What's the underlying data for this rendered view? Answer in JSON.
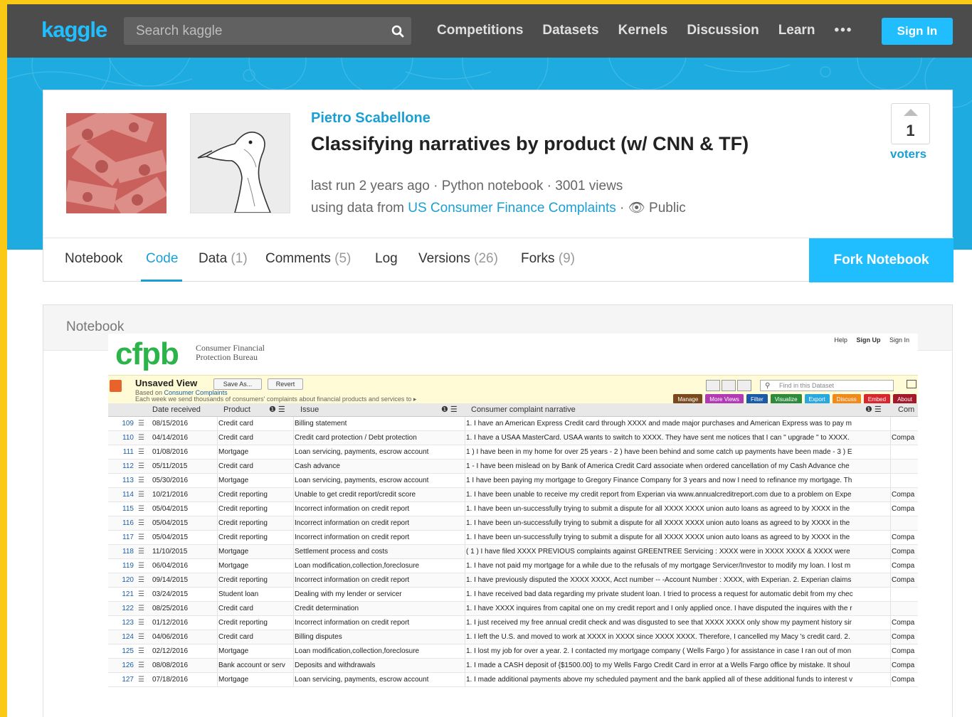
{
  "nav": {
    "logo": "kaggle",
    "search_placeholder": "Search kaggle",
    "links": [
      "Competitions",
      "Datasets",
      "Kernels",
      "Discussion",
      "Learn"
    ],
    "more": "•••",
    "signin": "Sign In"
  },
  "kernel": {
    "author": "Pietro Scabellone",
    "title": "Classifying narratives by product (w/ CNN & TF)",
    "meta_line1": "last run 2 years ago · Python notebook · 3001 views",
    "meta_prefix": "using data from ",
    "dataset_link": "US Consumer Finance Complaints",
    "meta_suffix": " · 👁 Public",
    "votes": "1",
    "voters_label": "voters"
  },
  "tabs": [
    {
      "label": "Notebook",
      "count": ""
    },
    {
      "label": "Code",
      "count": ""
    },
    {
      "label": "Data",
      "count": "(1)"
    },
    {
      "label": "Comments",
      "count": "(5)"
    },
    {
      "label": "Log",
      "count": ""
    },
    {
      "label": "Versions",
      "count": "(26)"
    },
    {
      "label": "Forks",
      "count": "(9)"
    }
  ],
  "fork_button": "Fork Notebook",
  "notebook_label": "Notebook",
  "cfpb": {
    "logo": "cfpb",
    "org_line1": "Consumer Financial",
    "org_line2": "Protection Bureau",
    "help": "Help",
    "signup": "Sign Up",
    "signin": "Sign In",
    "view_title": "Unsaved View",
    "save_as": "Save As...",
    "revert": "Revert",
    "based_on": "Based on ",
    "based_link": "Consumer Complaints",
    "description": "Each week we send thousands of consumers' complaints about financial products and services to ▸",
    "find_placeholder": "Find in this Dataset",
    "actions": [
      {
        "label": "Manage",
        "color": "#7a4a1e"
      },
      {
        "label": "More Views",
        "color": "#b23ab5"
      },
      {
        "label": "Filter",
        "color": "#1b5aa6"
      },
      {
        "label": "Visualize",
        "color": "#2e8b3d"
      },
      {
        "label": "Export",
        "color": "#29a8e0"
      },
      {
        "label": "Discuss",
        "color": "#f08a1b"
      },
      {
        "label": "Embed",
        "color": "#d9262e"
      },
      {
        "label": "About",
        "color": "#a3182a"
      }
    ],
    "columns": {
      "date": "Date received",
      "product": "Product",
      "issue": "Issue",
      "narrative": "Consumer complaint narrative",
      "company": "Com"
    },
    "rows": [
      {
        "n": "109",
        "date": "08/15/2016",
        "product": "Credit card",
        "issue": "Billing statement",
        "narrative": "1. I have an American Express Credit card through XXXX and made major purchases and American Express was to pay m",
        "company": ""
      },
      {
        "n": "110",
        "date": "04/14/2016",
        "product": "Credit card",
        "issue": "Credit card protection / Debt protection",
        "narrative": "1. I have a USAA MasterCard. USAA wants to switch to XXXX. They have sent me notices that I can \" upgrade \" to XXXX.",
        "company": "Compa"
      },
      {
        "n": "111",
        "date": "01/08/2016",
        "product": "Mortgage",
        "issue": "Loan servicing, payments, escrow account",
        "narrative": "1 ) I have been in my home for over 25 years - 2 ) have been behind and some catch up payments have been made - 3 ) E",
        "company": ""
      },
      {
        "n": "112",
        "date": "05/11/2015",
        "product": "Credit card",
        "issue": "Cash advance",
        "narrative": "1 - I have been mislead on by Bank of America Credit Card associate when ordered cancellation of my Cash Advance che",
        "company": ""
      },
      {
        "n": "113",
        "date": "05/30/2016",
        "product": "Mortgage",
        "issue": "Loan servicing, payments, escrow account",
        "narrative": "1 I have been paying my mortgage to Gregory Finance Company for 3 years and now I need to refinance my mortgage. Th",
        "company": ""
      },
      {
        "n": "114",
        "date": "10/21/2016",
        "product": "Credit reporting",
        "issue": "Unable to get credit report/credit score",
        "narrative": "1. I have been unable to receive my credit report from Experian via www.annualcreditreport.com due to a problem on Expe",
        "company": "Compa"
      },
      {
        "n": "115",
        "date": "05/04/2015",
        "product": "Credit reporting",
        "issue": "Incorrect information on credit report",
        "narrative": "1. I have been un-successfully trying to submit a dispute for all XXXX XXXX union auto loans as agreed to by XXXX in the",
        "company": "Compa"
      },
      {
        "n": "116",
        "date": "05/04/2015",
        "product": "Credit reporting",
        "issue": "Incorrect information on credit report",
        "narrative": "1. I have been un-successfully trying to submit a dispute for all XXXX XXXX union auto loans as agreed to by XXXX in the",
        "company": ""
      },
      {
        "n": "117",
        "date": "05/04/2015",
        "product": "Credit reporting",
        "issue": "Incorrect information on credit report",
        "narrative": "1. I have been un-successfully trying to submit a dispute for all XXXX XXXX union auto loans as agreed to by XXXX in the",
        "company": "Compa"
      },
      {
        "n": "118",
        "date": "11/10/2015",
        "product": "Mortgage",
        "issue": "Settlement process and costs",
        "narrative": "( 1 ) I have filed XXXX PREVIOUS complaints against GREENTREE Servicing : XXXX were in XXXX XXXX & XXXX were",
        "company": "Compa"
      },
      {
        "n": "119",
        "date": "06/04/2016",
        "product": "Mortgage",
        "issue": "Loan modification,collection,foreclosure",
        "narrative": "1. I have not paid my mortgage for a while due to the refusals of my mortgage Servicer/Investor to modify my loan. I lost m",
        "company": "Compa"
      },
      {
        "n": "120",
        "date": "09/14/2015",
        "product": "Credit reporting",
        "issue": "Incorrect information on credit report",
        "narrative": "1. I have previously disputed the XXXX XXXX, Acct number -- -Account Number : XXXX, with Experian. 2. Experian claims",
        "company": "Compa"
      },
      {
        "n": "121",
        "date": "03/24/2015",
        "product": "Student loan",
        "issue": "Dealing with my lender or servicer",
        "narrative": "1. I have received bad data regarding my private student loan. I tried to process a request for automatic debit from my chec",
        "company": ""
      },
      {
        "n": "122",
        "date": "08/25/2016",
        "product": "Credit card",
        "issue": "Credit determination",
        "narrative": "1. I have XXXX inquires from capital one on my credit report and I only applied once. I have disputed the inquires with the r",
        "company": ""
      },
      {
        "n": "123",
        "date": "01/12/2016",
        "product": "Credit reporting",
        "issue": "Incorrect information on credit report",
        "narrative": "1. I just received my free annual credit check and was disgusted to see that XXXX XXXX only show my payment history sir",
        "company": "Compa"
      },
      {
        "n": "124",
        "date": "04/06/2016",
        "product": "Credit card",
        "issue": "Billing disputes",
        "narrative": "1. I left the U.S. and moved to work at XXXX in XXXX since XXXX XXXX. Therefore, I cancelled my Macy 's credit card. 2.",
        "company": "Compa"
      },
      {
        "n": "125",
        "date": "02/12/2016",
        "product": "Mortgage",
        "issue": "Loan modification,collection,foreclosure",
        "narrative": "1. I lost my job for over a year. 2. I contacted my mortgage company ( Wells Fargo ) for assistance in case I ran out of mon",
        "company": "Compa"
      },
      {
        "n": "126",
        "date": "08/08/2016",
        "product": "Bank account or serv",
        "issue": "Deposits and withdrawals",
        "narrative": "1. I made a CASH deposit of {$1500.00} to my Wells Fargo Credit Card in error at a Wells Fargo office by mistake. It shoul",
        "company": "Compa"
      },
      {
        "n": "127",
        "date": "07/18/2016",
        "product": "Mortgage",
        "issue": "Loan servicing, payments, escrow account",
        "narrative": "1. I made additional payments above my scheduled payment and the bank applied all of these additional funds to interest v",
        "company": "Compa"
      }
    ]
  }
}
